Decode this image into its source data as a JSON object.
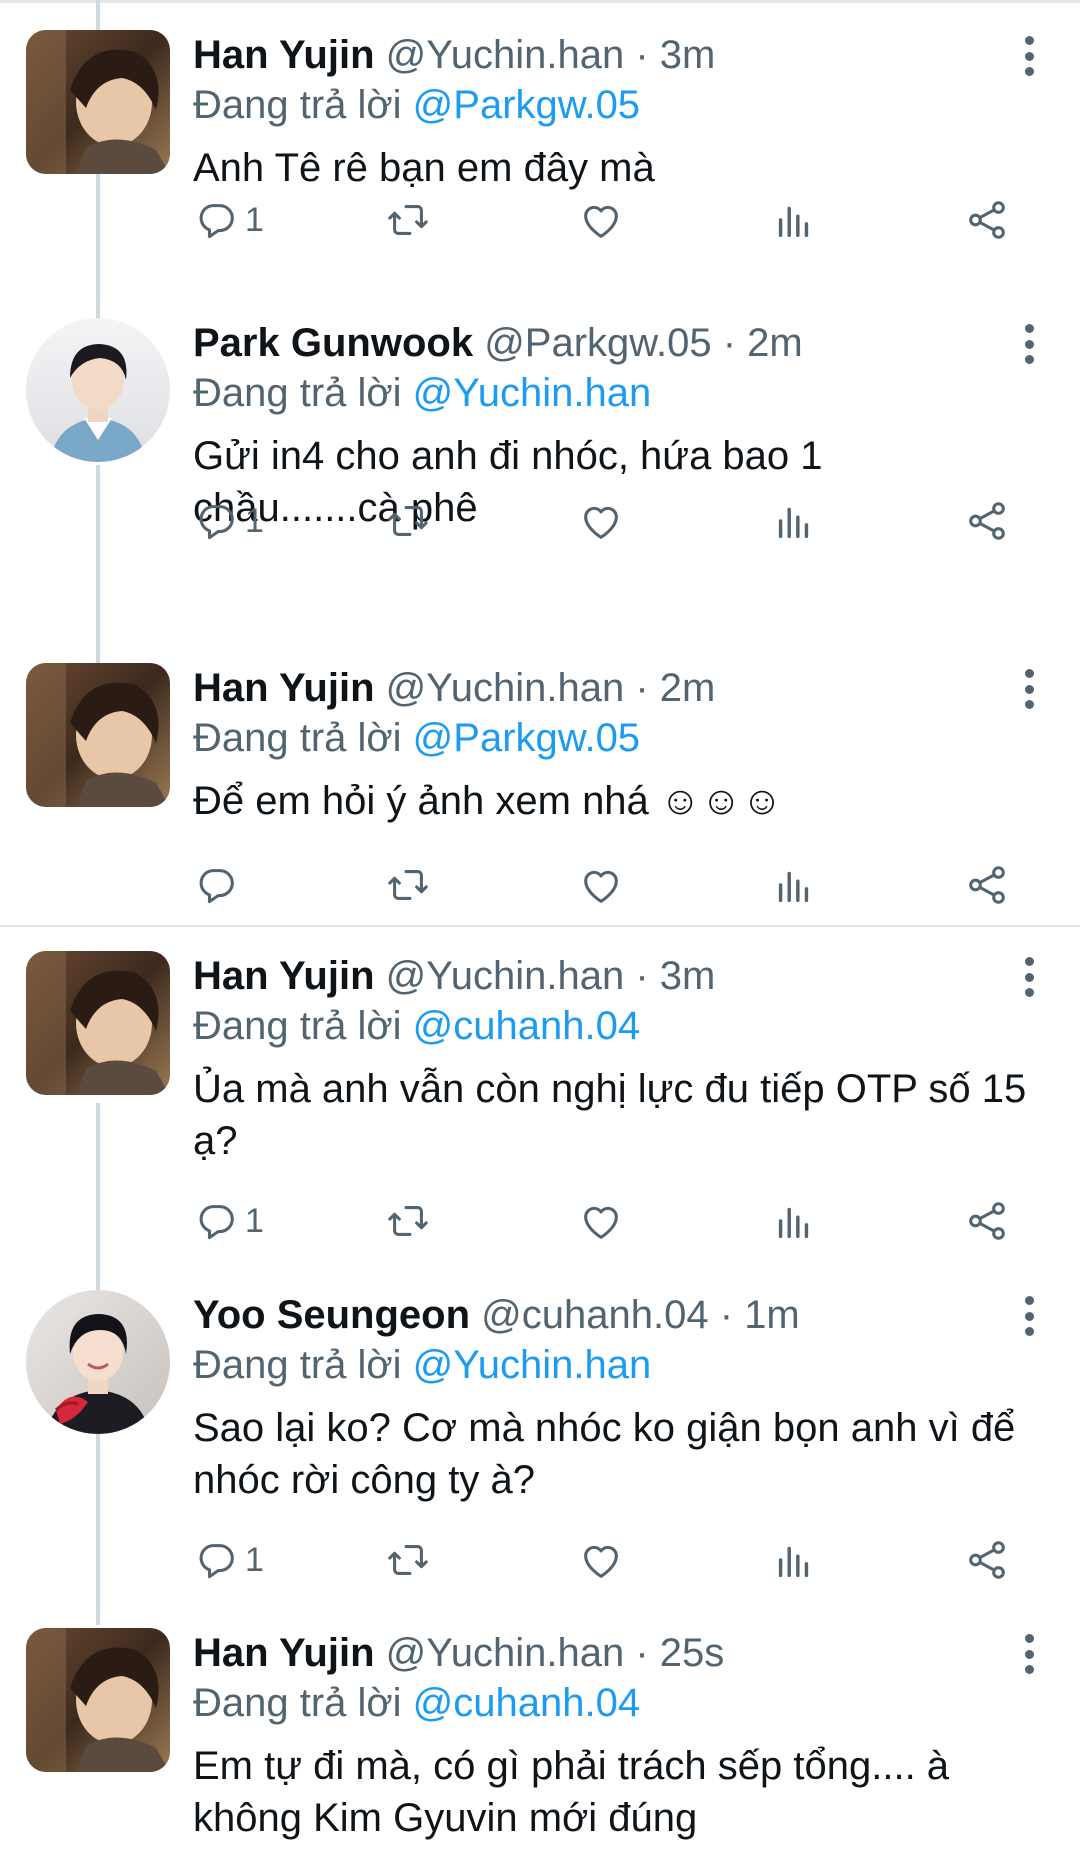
{
  "tweets": [
    {
      "name": "Han Yujin",
      "handle": "@Yuchin.han",
      "separator": "·",
      "time": "3m",
      "replying_prefix": "Đang trả lời",
      "replying_to": "@Parkgw.05",
      "text": "Anh Tê rê bạn em đây mà",
      "reply_count": "1",
      "avatar": "avatar-yujin",
      "avatar_shape": "square"
    },
    {
      "name": "Park Gunwook",
      "handle": "@Parkgw.05",
      "separator": "·",
      "time": "2m",
      "replying_prefix": "Đang trả lời",
      "replying_to": "@Yuchin.han",
      "text": "Gửi in4 cho anh đi nhóc, hứa bao 1 chầu.......cà phê",
      "reply_count": "1",
      "avatar": "avatar-gunwook",
      "avatar_shape": "round"
    },
    {
      "name": "Han Yujin",
      "handle": "@Yuchin.han",
      "separator": "·",
      "time": "2m",
      "replying_prefix": "Đang trả lời",
      "replying_to": "@Parkgw.05",
      "text": "Để em hỏi ý ảnh xem nhá ☺☺☺",
      "reply_count": "",
      "avatar": "avatar-yujin",
      "avatar_shape": "square"
    },
    {
      "name": "Han Yujin",
      "handle": "@Yuchin.han",
      "separator": "·",
      "time": "3m",
      "replying_prefix": "Đang trả lời",
      "replying_to": "@cuhanh.04",
      "text": "Ủa mà anh vẫn còn nghị lực đu tiếp OTP số 15 ạ?",
      "reply_count": "1",
      "avatar": "avatar-yujin",
      "avatar_shape": "square"
    },
    {
      "name": "Yoo Seungeon",
      "handle": "@cuhanh.04",
      "separator": "·",
      "time": "1m",
      "replying_prefix": "Đang trả lời",
      "replying_to": "@Yuchin.han",
      "text": "Sao lại ko? Cơ mà nhóc ko giận bọn anh vì để nhóc rời công ty à?",
      "reply_count": "1",
      "avatar": "avatar-seungeon",
      "avatar_shape": "round"
    },
    {
      "name": "Han Yujin",
      "handle": "@Yuchin.han",
      "separator": "·",
      "time": "25s",
      "replying_prefix": "Đang trả lời",
      "replying_to": "@cuhanh.04",
      "text": "Em tự đi mà, có gì phải trách sếp tổng.... à không Kim Gyuvin mới đúng",
      "reply_count": "",
      "avatar": "avatar-yujin",
      "avatar_shape": "square"
    }
  ],
  "icons": {
    "reply": "reply-icon",
    "retweet": "retweet-icon",
    "like": "heart-icon",
    "views": "views-icon",
    "share": "share-icon",
    "more": "more-vertical-icon"
  },
  "colors": {
    "text": "#0f1419",
    "secondary": "#536471",
    "mention": "#1d9bf0",
    "thread_line": "#cfd9de"
  }
}
